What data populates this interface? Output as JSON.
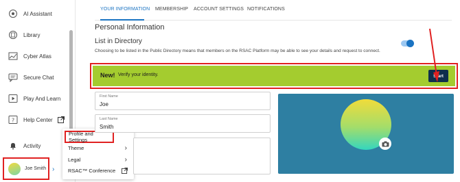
{
  "sidebar": {
    "items": [
      {
        "label": "AI Assistant",
        "icon": "ai-assistant-icon"
      },
      {
        "label": "Library",
        "icon": "library-icon"
      },
      {
        "label": "Cyber Atlas",
        "icon": "cyber-atlas-icon"
      },
      {
        "label": "Secure Chat",
        "icon": "chat-icon"
      },
      {
        "label": "Play And Learn",
        "icon": "play-icon"
      },
      {
        "label": "Help Center",
        "icon": "help-icon"
      },
      {
        "label": "Activity",
        "icon": "bell-icon"
      }
    ],
    "user": {
      "name": "Joe Smith"
    }
  },
  "popup_menu": {
    "items": [
      {
        "label": "Profile and Settings"
      },
      {
        "label": "Theme"
      },
      {
        "label": "Legal"
      },
      {
        "label": "RSAC™ Conference"
      }
    ]
  },
  "tabs": [
    {
      "label": "YOUR INFORMATION",
      "active": true
    },
    {
      "label": "MEMBERSHIP"
    },
    {
      "label": "ACCOUNT SETTINGS"
    },
    {
      "label": "NOTIFICATIONS"
    }
  ],
  "main": {
    "section_title": "Personal Information",
    "list_title": "List in Directory",
    "list_desc": "Choosing to be listed in the Public Directory means that members on the RSAC Platform may be able to see your details and request to connect.",
    "list_toggle_on": true,
    "banner": {
      "new_label": "New!",
      "text": "Verify your identity.",
      "button": "Start"
    },
    "first_name": {
      "label": "First Name",
      "value": "Joe"
    },
    "last_name": {
      "label": "Last Name",
      "value": "Smith"
    }
  },
  "colors": {
    "accent": "#1a73c2",
    "banner": "#a4cc2f",
    "highlight": "#e02020",
    "button_dark": "#0e2f4d",
    "photo_bg": "#2e7fa2"
  }
}
